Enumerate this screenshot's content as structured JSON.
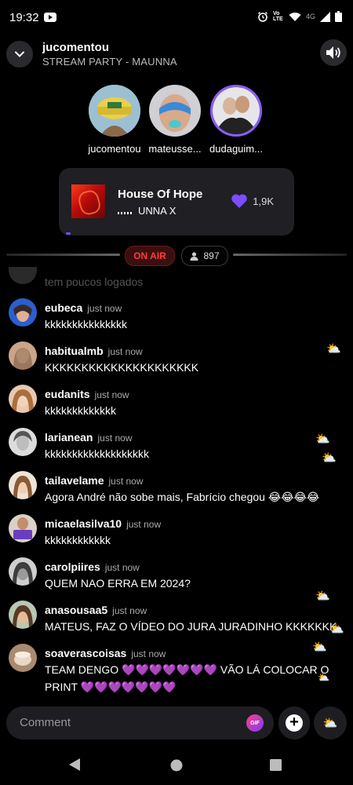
{
  "status_bar": {
    "time": "19:32",
    "network": "4G",
    "volte": "Vo LTE"
  },
  "header": {
    "title": "jucomentou",
    "subtitle": "STREAM PARTY - MAUNNA"
  },
  "participants": [
    {
      "name": "jucomentou"
    },
    {
      "name": "mateusse..."
    },
    {
      "name": "dudaguim..."
    }
  ],
  "now_playing": {
    "title": "House Of Hope",
    "artist": "UNNA X",
    "likes": "1,9K"
  },
  "live": {
    "badge": "ON AIR",
    "listeners": "897"
  },
  "chat": {
    "faded_message": "tem poucos logados",
    "messages": [
      {
        "user": "eubeca",
        "time": "just now",
        "text": "kkkkkkkkkkkkkkk"
      },
      {
        "user": "habitualmb",
        "time": "just now",
        "text": "KKKKKKKKKKKKKKKKKKKKK"
      },
      {
        "user": "eudanits",
        "time": "just now",
        "text": "kkkkkkkkkkkkk"
      },
      {
        "user": "larianean",
        "time": "just now",
        "text": "kkkkkkkkkkkkkkkkkkk"
      },
      {
        "user": "tailavelame",
        "time": "just now",
        "text": "Agora André não sobe mais, Fabrício chegou 😂😂😂😂"
      },
      {
        "user": "micaelasilva10",
        "time": "just now",
        "text": "kkkkkkkkkkkk"
      },
      {
        "user": "carolpiires",
        "time": "just now",
        "text": "QUEM NAO ERRA EM 2024?"
      },
      {
        "user": "anasousaa5",
        "time": "just now",
        "text": "MATEUS, FAZ O VÍDEO DO JURA JURADINHO KKKKKKK"
      },
      {
        "user": "soaverascoisas",
        "time": "just now",
        "text": "TEAM DENGO 💜💜💜💜💜💜💜 VÃO LÁ COLOCAR O PRINT 💜💜💜💜💜💜💜"
      }
    ]
  },
  "composer": {
    "placeholder": "Comment",
    "gif_label": "GIF",
    "add_label": "+"
  },
  "weather_emoji": "⛅",
  "colors": {
    "accent_purple": "#7b4dff",
    "on_air_red": "#ff3b3b",
    "background": "#000000"
  }
}
